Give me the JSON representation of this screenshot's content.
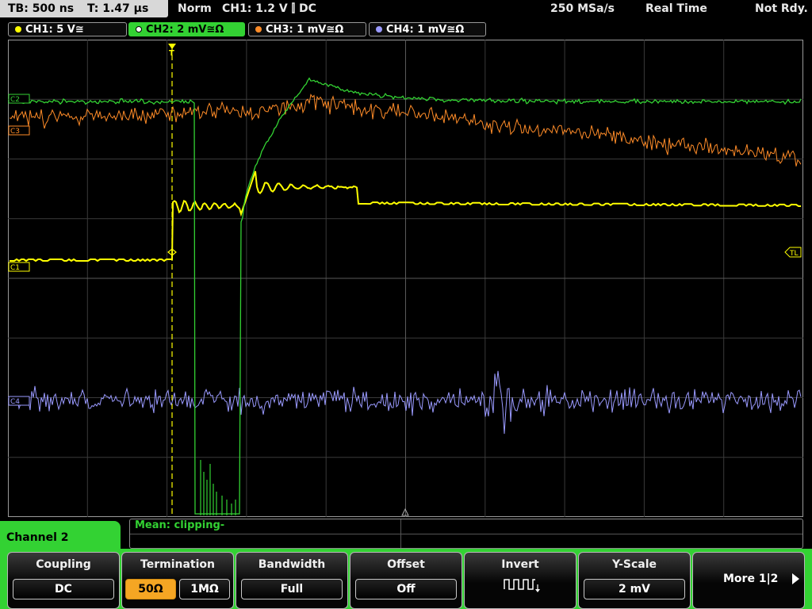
{
  "header": {
    "timebase": "TB: 500 ns",
    "trigger_time": "T: 1.47 µs",
    "mode": "Norm",
    "trigger_setting": "CH1: 1.2 V ⫿ DC",
    "sample_rate": "250 MSa/s",
    "acquisition": "Real Time",
    "status": "Not Rdy."
  },
  "channels": [
    {
      "label": "CH1: 5 V≅",
      "color": "#ffff00"
    },
    {
      "label": "CH2: 2 mV≅Ω",
      "color": "#33d233"
    },
    {
      "label": "CH3: 1 mV≅Ω",
      "color": "#ff8c28"
    },
    {
      "label": "CH4: 1 mV≅Ω",
      "color": "#9a9aff"
    }
  ],
  "markers": {
    "ch2": "C2",
    "ch3": "C3",
    "ch1": "C1",
    "ch4": "C4",
    "trigger_level": "TL",
    "trigger_position": "T"
  },
  "measurement": {
    "text": "Mean: clipping-"
  },
  "menu": {
    "title": "Channel 2",
    "coupling": {
      "label": "Coupling",
      "value": "DC"
    },
    "termination": {
      "label": "Termination",
      "option_50": "50Ω",
      "option_1m": "1MΩ"
    },
    "bandwidth": {
      "label": "Bandwidth",
      "value": "Full"
    },
    "offset": {
      "label": "Offset",
      "value": "Off"
    },
    "invert": {
      "label": "Invert",
      "icon": "square-wave-icon"
    },
    "yscale": {
      "label": "Y-Scale",
      "value": "2 mV"
    },
    "more": {
      "label": "More 1|2"
    }
  }
}
